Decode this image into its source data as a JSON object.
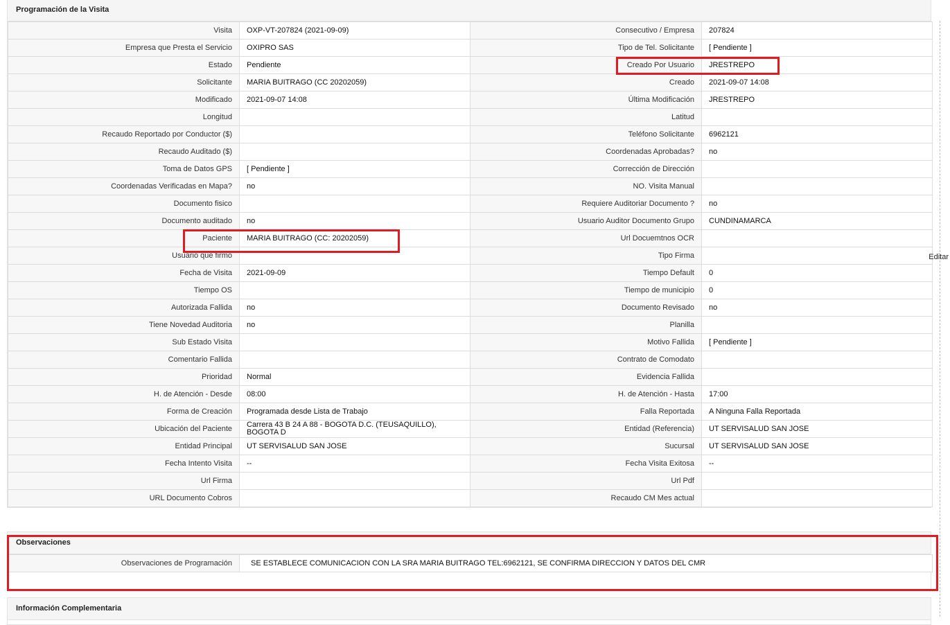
{
  "sections": {
    "programacion": "Programación de la Visita",
    "observaciones": "Observaciones",
    "informacion": "Información Complementaria"
  },
  "edit_label": "Editar",
  "rows": [
    {
      "l1": "Visita",
      "v1": "OXP-VT-207824 (2021-09-09)",
      "l2": "Consecutivo / Empresa",
      "v2": "207824"
    },
    {
      "l1": "Empresa que Presta el Servicio",
      "v1": "OXIPRO SAS",
      "l2": "Tipo de Tel. Solicitante",
      "v2": "[ Pendiente ]"
    },
    {
      "l1": "Estado",
      "v1": "Pendiente",
      "l2": "Creado Por Usuario",
      "v2": "JRESTREPO"
    },
    {
      "l1": "Solicitante",
      "v1": "MARIA BUITRAGO (CC 20202059)",
      "l2": "Creado",
      "v2": "2021-09-07 14:08"
    },
    {
      "l1": "Modificado",
      "v1": "2021-09-07 14:08",
      "l2": "Última Modificación",
      "v2": " JRESTREPO"
    },
    {
      "l1": "Longitud",
      "v1": "",
      "l2": "Latitud",
      "v2": ""
    },
    {
      "l1": "Recaudo Reportado por Conductor ($)",
      "v1": "",
      "l2": "Teléfono Solicitante",
      "v2": "6962121"
    },
    {
      "l1": "Recaudo Auditado ($)",
      "v1": "",
      "l2": "Coordenadas Aprobadas?",
      "v2": " no"
    },
    {
      "l1": "Toma de Datos GPS",
      "v1": "[ Pendiente ]",
      "l2": "Corrección de Dirección",
      "v2": ""
    },
    {
      "l1": "Coordenadas Verificadas en Mapa?",
      "v1": " no",
      "l2": "NO. Visita Manual",
      "v2": ""
    },
    {
      "l1": "Documento fisico",
      "v1": "",
      "l2": "Requiere Auditoriar Documento ?",
      "v2": " no"
    },
    {
      "l1": "Documento auditado",
      "v1": " no",
      "l2": "Usuario Auditor Documento Grupo",
      "v2": "CUNDINAMARCA"
    },
    {
      "l1": "Paciente",
      "v1": "MARIA BUITRAGO (CC: 20202059)",
      "l2": "Url Docuemtnos OCR",
      "v2": ""
    },
    {
      "l1": "Usuario que firmo",
      "v1": "",
      "l2": "Tipo Firma",
      "v2": ""
    },
    {
      "l1": "Fecha de Visita",
      "v1": " 2021-09-09",
      "l2": "Tiempo Default",
      "v2": "0"
    },
    {
      "l1": "Tiempo OS",
      "v1": "",
      "l2": "Tiempo de municipio",
      "v2": "0"
    },
    {
      "l1": "Autorizada Fallida",
      "v1": " no",
      "l2": "Documento Revisado",
      "v2": " no"
    },
    {
      "l1": "Tiene Novedad Auditoria",
      "v1": " no",
      "l2": "Planilla",
      "v2": ""
    },
    {
      "l1": "Sub Estado Visita",
      "v1": "",
      "l2": "Motivo Fallida",
      "v2": "[ Pendiente ]"
    },
    {
      "l1": "Comentario Fallida",
      "v1": "",
      "l2": "Contrato de Comodato",
      "v2": ""
    },
    {
      "l1": "Prioridad",
      "v1": "Normal",
      "l2": "Evidencia Fallida",
      "v2": ""
    },
    {
      "l1": "H. de Atención - Desde",
      "v1": "08:00",
      "l2": "H. de Atención - Hasta",
      "v2": "17:00"
    },
    {
      "l1": "Forma de Creación",
      "v1": "Programada desde Lista de Trabajo",
      "l2": "Falla Reportada",
      "v2": "A Ninguna Falla Reportada"
    },
    {
      "l1": "Ubicación del Paciente",
      "v1": "Carrera 43 B 24 A 88 - BOGOTA D.C. (TEUSAQUILLO), BOGOTA D",
      "l2": "Entidad (Referencia)",
      "v2": "UT SERVISALUD SAN JOSE"
    },
    {
      "l1": "Entidad Principal",
      "v1": "UT SERVISALUD SAN JOSE",
      "l2": "Sucursal",
      "v2": "UT SERVISALUD SAN JOSE"
    },
    {
      "l1": "Fecha Intento Visita",
      "v1": " --",
      "l2": "Fecha Visita Exitosa",
      "v2": " --"
    },
    {
      "l1": "Url Firma",
      "v1": "",
      "l2": "Url Pdf",
      "v2": ""
    },
    {
      "l1": "URL Documento Cobros",
      "v1": "",
      "l2": "Recaudo CM Mes actual",
      "v2": ""
    }
  ],
  "observaciones": {
    "label": "Observaciones de Programación",
    "value": "SE ESTABLECE COMUNICACION CON LA SRA MARIA BUITRAGO TEL:6962121, SE CONFIRMA DIRECCION Y DATOS DEL CMR"
  }
}
